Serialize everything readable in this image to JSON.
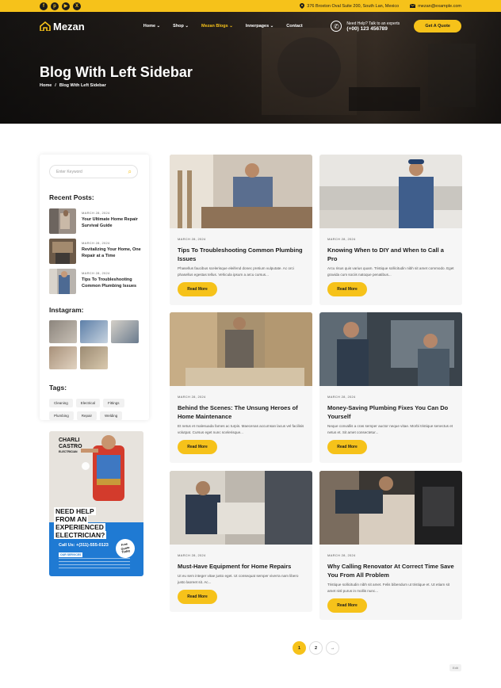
{
  "topbar": {
    "socials": [
      "facebook-icon",
      "pinterest-icon",
      "youtube-icon",
      "x-icon"
    ],
    "social_glyphs": [
      "f",
      "p",
      "▶",
      "X"
    ],
    "address": "376 Broxton Oval Suite 200, South Lan, Mexico",
    "email": "mezan@example.com"
  },
  "header": {
    "logo": "Mezan",
    "menu": [
      {
        "label": "Home ⌄",
        "active": false
      },
      {
        "label": "Shop ⌄",
        "active": false
      },
      {
        "label": "Mezan Blogs ⌄",
        "active": true
      },
      {
        "label": "Innerpages ⌄",
        "active": false
      },
      {
        "label": "Contact",
        "active": false
      }
    ],
    "help_text": "Need Help? Talk to an experts",
    "phone": "(+00) 123 456789",
    "quote_button": "Get A Quote"
  },
  "hero": {
    "title": "Blog With Left Sidebar",
    "breadcrumb_home": "Home",
    "breadcrumb_sep": "/",
    "breadcrumb_current": "Blog With Left Sidebar"
  },
  "sidebar": {
    "search_placeholder": "Enter Keyword",
    "recent_heading": "Recent Posts:",
    "recent_posts": [
      {
        "date": "MARCH 28, 2024",
        "title": "Your Ultimate Home Repair Survival Guide"
      },
      {
        "date": "MARCH 28, 2024",
        "title": "Revitalizing Your Home, One Repair at a Time"
      },
      {
        "date": "MARCH 28, 2024",
        "title": "Tips To Troubleshooting Common Plumbing Issues"
      }
    ],
    "instagram_heading": "Instagram:",
    "tags_heading": "Tags:",
    "tags": [
      "Cleaning",
      "Electrical",
      "Fittings",
      "Plumbing",
      "Repair",
      "Welding"
    ]
  },
  "promo": {
    "name_line1": "CHARLI",
    "name_line2": "CASTRO",
    "role": "ELECTRICIAN",
    "headline": [
      "NEED HELP",
      "FROM AN",
      "EXPERIENCED",
      "ELECTRICIAN?"
    ],
    "call": "Call Us: +(311)-555-0123",
    "services_label": "OUR SERVICES",
    "badge": [
      "Free",
      "Quote",
      "Today"
    ]
  },
  "posts": [
    {
      "date": "MARCH 28, 2024",
      "title": "Tips To Troubleshooting Common Plumbing Issues",
      "excerpt": "Phasellus faucibus scelerisque eleifend donec pretium vulputate. Ac orci phasellus egestas tellus. Vehicula ipsum a arcu cursus...",
      "button": "Read More"
    },
    {
      "date": "MARCH 28, 2024",
      "title": "Knowing When to DIY and When to Call a Pro",
      "excerpt": "Arcu risus quis varius quam. Tristique sollicitudin nibh sit amet commodo. Eget gravida cum sociis natoque penatibus...",
      "button": "Read More"
    },
    {
      "date": "MARCH 28, 2024",
      "title": "Behind the Scenes: The Unsung Heroes of Home Maintenance",
      "excerpt": "Et netus et malesuada fames ac turpis. Maecenas accumsan lacus vel facilisis volutpat. Cursus eget nunc scelerisque...",
      "button": "Read More"
    },
    {
      "date": "MARCH 28, 2024",
      "title": "Money-Saving Plumbing Fixes You Can Do Yourself",
      "excerpt": "Neque convallis a cras semper auctor neque vitae. Morbi tristique senectus et netus et. Sit amet consectetur...",
      "button": "Read More"
    },
    {
      "date": "MARCH 28, 2024",
      "title": "Must-Have Equipment for Home Repairs",
      "excerpt": "Ut eu sem integer vitae justo eget. Ut consequat semper viverra nam libero justo laoreet sit. Ac...",
      "button": "Read More"
    },
    {
      "date": "MARCH 28, 2024",
      "title": "Why Calling Renovator At Correct Time Save You From All Problem",
      "excerpt": "Tristique sollicitudin nibh sit amet. Felis bibendum ut tristique et. Ut etiam sit amet nisl purus in mollis nunc...",
      "button": "Read More"
    }
  ],
  "pagination": {
    "pages": [
      "1",
      "2"
    ],
    "next": "→"
  },
  "edit_badge": "Edit",
  "colors": {
    "accent": "#f6c21a",
    "dark": "#1c1c1c",
    "card_bg": "#f6f6f6",
    "promo_blue": "#1f7ad3"
  }
}
